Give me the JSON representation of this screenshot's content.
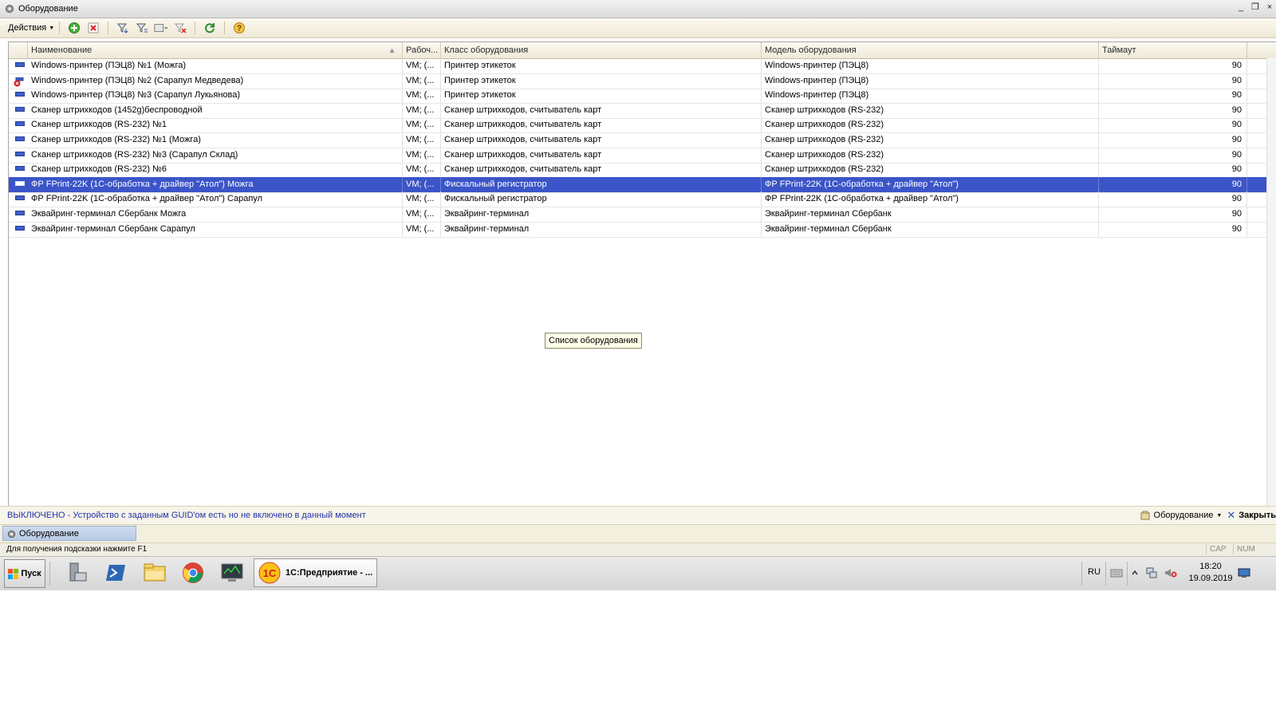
{
  "window": {
    "title": "Оборудование",
    "controls": [
      "_",
      "❐",
      "×"
    ]
  },
  "toolbar": {
    "actions_label": "Действия",
    "icons": [
      "add-icon",
      "delete-icon",
      "filter-set-icon",
      "filter-list-icon",
      "filter-dropdown-icon",
      "filter-clear-icon",
      "refresh-icon",
      "help-icon"
    ]
  },
  "grid": {
    "columns": [
      "Наименование",
      "Рабоч...",
      "Класс оборудования",
      "Модель оборудования",
      "Таймаут"
    ],
    "rows": [
      {
        "name": "Windows-принтер (ПЭЦ8) №1 (Можга)",
        "ws": "VM; (...",
        "class": "Принтер этикеток",
        "model": "Windows-принтер (ПЭЦ8)",
        "timeout": "90",
        "state": "ok"
      },
      {
        "name": "Windows-принтер (ПЭЦ8) №2 (Сарапул Медведева)",
        "ws": "VM; (...",
        "class": "Принтер этикеток",
        "model": "Windows-принтер (ПЭЦ8)",
        "timeout": "90",
        "state": "error"
      },
      {
        "name": "Windows-принтер (ПЭЦ8) №3 (Сарапул Лукьянова)",
        "ws": "VM; (...",
        "class": "Принтер этикеток",
        "model": "Windows-принтер (ПЭЦ8)",
        "timeout": "90",
        "state": "ok"
      },
      {
        "name": "Сканер штрихкодов (1452g)беспроводной",
        "ws": "VM; (...",
        "class": "Сканер штрихкодов, считыватель карт",
        "model": "Сканер штрихкодов (RS-232)",
        "timeout": "90",
        "state": "ok"
      },
      {
        "name": "Сканер штрихкодов (RS-232) №1",
        "ws": "VM; (...",
        "class": "Сканер штрихкодов, считыватель карт",
        "model": "Сканер штрихкодов (RS-232)",
        "timeout": "90",
        "state": "ok"
      },
      {
        "name": "Сканер штрихкодов (RS-232) №1 (Можга)",
        "ws": "VM; (...",
        "class": "Сканер штрихкодов, считыватель карт",
        "model": "Сканер штрихкодов (RS-232)",
        "timeout": "90",
        "state": "ok"
      },
      {
        "name": "Сканер штрихкодов (RS-232) №3 (Сарапул Склад)",
        "ws": "VM; (...",
        "class": "Сканер штрихкодов, считыватель карт",
        "model": "Сканер штрихкодов (RS-232)",
        "timeout": "90",
        "state": "ok"
      },
      {
        "name": "Сканер штрихкодов (RS-232) №6",
        "ws": "VM; (...",
        "class": "Сканер штрихкодов, считыватель карт",
        "model": "Сканер штрихкодов (RS-232)",
        "timeout": "90",
        "state": "ok"
      },
      {
        "name": "ФР FPrint-22K (1С-обработка + драйвер \"Атол\") Можга",
        "ws": "VM; (...",
        "class": "Фискальный регистратор",
        "model": "ФР FPrint-22K (1С-обработка + драйвер \"Атол\")",
        "timeout": "90",
        "state": "ok",
        "selected": true
      },
      {
        "name": "ФР FPrint-22K (1С-обработка + драйвер \"Атол\") Сарапул",
        "ws": "VM; (...",
        "class": "Фискальный регистратор",
        "model": "ФР FPrint-22K (1С-обработка + драйвер \"Атол\")",
        "timeout": "90",
        "state": "ok"
      },
      {
        "name": "Эквайринг-терминал Сбербанк Можга",
        "ws": "VM; (...",
        "class": "Эквайринг-терминал",
        "model": "Эквайринг-терминал Сбербанк",
        "timeout": "90",
        "state": "ok"
      },
      {
        "name": "Эквайринг-терминал Сбербанк Сарапул",
        "ws": "VM; (...",
        "class": "Эквайринг-терминал",
        "model": "Эквайринг-терминал Сбербанк",
        "timeout": "90",
        "state": "ok"
      }
    ]
  },
  "tooltip": "Список оборудования",
  "infobar": {
    "message": "ВЫКЛЮЧЕНО - Устройство с заданным GUID'ом есть но не включено в данный момент",
    "equipment_button": "Оборудование",
    "close_button": "Закрыть"
  },
  "window_tabs": [
    "Оборудование"
  ],
  "statusbar": {
    "hint": "Для получения подсказки нажмите F1",
    "indicators": [
      "CAP",
      "NUM"
    ]
  },
  "taskbar": {
    "start_label": "Пуск",
    "active_task": "1С:Предприятие - ...",
    "lang": "RU",
    "time": "18:20",
    "date": "19.09.2019"
  },
  "colors": {
    "selection": "#3b55c8",
    "info_text": "#2233aa",
    "toolbar_bg": "#efe9d5"
  }
}
